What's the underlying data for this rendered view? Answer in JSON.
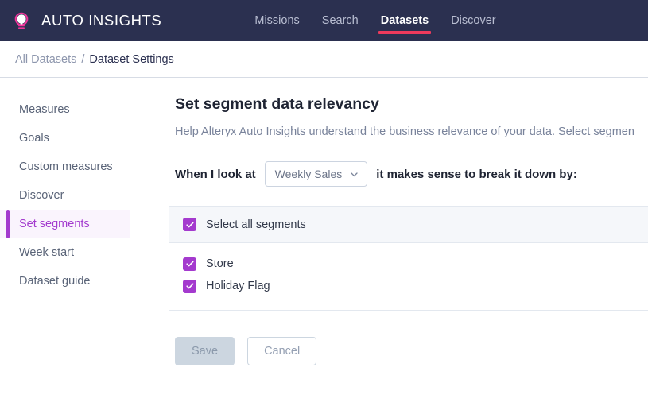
{
  "header": {
    "brand": "AUTO INSIGHTS",
    "logo_icon": "lightbulb-icon",
    "nav": [
      {
        "label": "Missions",
        "active": false
      },
      {
        "label": "Search",
        "active": false
      },
      {
        "label": "Datasets",
        "active": true
      },
      {
        "label": "Discover",
        "active": false
      }
    ],
    "accent_active": "#ee3a5c",
    "background": "#2b3050"
  },
  "breadcrumb": {
    "parent": "All Datasets",
    "separator": "/",
    "current": "Dataset Settings"
  },
  "sidebar": {
    "items": [
      {
        "label": "Measures",
        "active": false
      },
      {
        "label": "Goals",
        "active": false
      },
      {
        "label": "Custom measures",
        "active": false
      },
      {
        "label": "Discover",
        "active": false
      },
      {
        "label": "Set segments",
        "active": true
      },
      {
        "label": "Week start",
        "active": false
      },
      {
        "label": "Dataset guide",
        "active": false
      }
    ],
    "active_color": "#a33ace"
  },
  "main": {
    "title": "Set segment data relevancy",
    "description": "Help Alteryx Auto Insights understand the business relevance of your data. Select segmen",
    "sentence_prefix": "When I look at",
    "sentence_suffix": "it makes sense to break it down by:",
    "measure_select": {
      "value": "Weekly Sales",
      "icon": "chevron-down-icon"
    },
    "select_all": {
      "label": "Select all segments",
      "checked": true
    },
    "segments": [
      {
        "label": "Store",
        "checked": true
      },
      {
        "label": "Holiday Flag",
        "checked": true
      }
    ],
    "checkbox_color": "#a43ace"
  },
  "actions": {
    "save_label": "Save",
    "save_disabled": true,
    "cancel_label": "Cancel"
  }
}
